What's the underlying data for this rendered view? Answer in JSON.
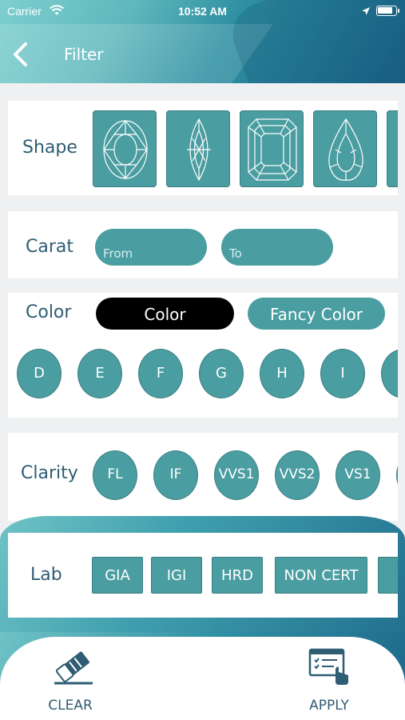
{
  "status_bar": {
    "carrier": "Carrier",
    "time": "10:52 AM"
  },
  "header": {
    "title": "Filter"
  },
  "shape": {
    "label": "Shape",
    "tiles": [
      "oval-shape-icon",
      "marquise-shape-icon",
      "emerald-shape-icon",
      "pear-shape-icon"
    ]
  },
  "carat": {
    "label": "Carat",
    "from_placeholder": "From",
    "to_placeholder": "To"
  },
  "color": {
    "label": "Color",
    "toggle_color": "Color",
    "toggle_fancy": "Fancy Color",
    "grades": [
      "D",
      "E",
      "F",
      "G",
      "H",
      "I"
    ]
  },
  "clarity": {
    "label": "Clarity",
    "grades": [
      "FL",
      "IF",
      "VVS1",
      "VVS2",
      "VS1"
    ]
  },
  "lab": {
    "label": "Lab",
    "options": [
      "GIA",
      "IGI",
      "HRD",
      "NON CERT"
    ]
  },
  "actions": {
    "clear": "CLEAR",
    "apply": "APPLY"
  },
  "colors": {
    "accent": "#4a9da0",
    "text": "#2f5d73",
    "header_dark": "#1a6589"
  }
}
